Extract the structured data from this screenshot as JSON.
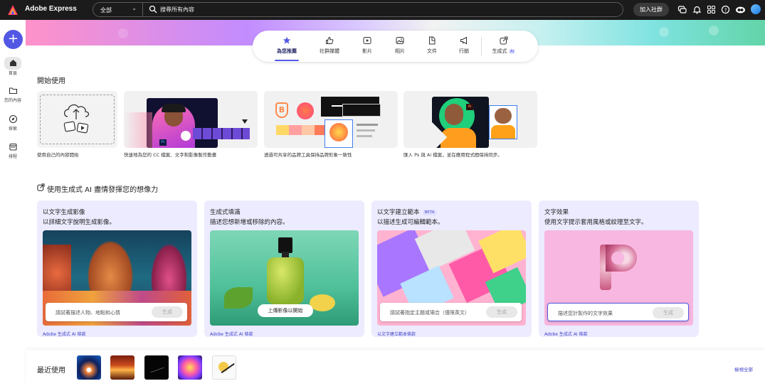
{
  "app": {
    "title": "Adobe Express"
  },
  "search": {
    "scope": "全部",
    "placeholder": "搜尋所有內容"
  },
  "header": {
    "join_label": "加入社群"
  },
  "rail": {
    "items": [
      {
        "label": "首頁"
      },
      {
        "label": "您的內容"
      },
      {
        "label": "探索"
      },
      {
        "label": "排程"
      }
    ]
  },
  "tabs": [
    {
      "label": "為您推薦"
    },
    {
      "label": "社群媒體"
    },
    {
      "label": "影片"
    },
    {
      "label": "相片"
    },
    {
      "label": "文件"
    },
    {
      "label": "行銷"
    },
    {
      "label": "生成式",
      "badge": "AI"
    }
  ],
  "getting_started": {
    "title": "開始使用",
    "cards": [
      {
        "caption": "使用自己的內容開始"
      },
      {
        "caption": "快速地為您的 CC 檔案、文字和影像製作動畫"
      },
      {
        "caption": "透過可共享的品牌工具保持品牌形象一致性"
      },
      {
        "caption": "匯入 Ps 與 Ai 檔案，並在應用程式間保持同步。"
      }
    ]
  },
  "ai_section": {
    "title": "使用生成式 AI 盡情發揮您的想像力",
    "cards": [
      {
        "title": "以文字生成影像",
        "subtitle": "以詳細文字說明生成影像。",
        "prompt": "請試著描述人物、地點和心情",
        "button": "生成",
        "footer": "Adobe 生成式 AI 條款"
      },
      {
        "title": "生成式填滿",
        "subtitle": "描述您想新增或移除的內容。",
        "button": "上傳影像以開始",
        "footer": "Adobe 生成式 AI 條款"
      },
      {
        "title": "以文字建立範本",
        "badge": "BETA",
        "subtitle": "以描述生成可編輯範本。",
        "prompt": "請試著指定主題或場合（僅限英文）",
        "button": "生成",
        "footer": "以文字建立範本條款"
      },
      {
        "title": "文字效果",
        "subtitle": "使用文字提示套用風格或紋理至文字。",
        "prompt": "描述您計製作的文字效果",
        "button": "生成",
        "footer": "Adobe 生成式 AI 條款"
      }
    ]
  },
  "recent": {
    "title": "最近使用",
    "view_all": "檢視全部"
  },
  "colors": {
    "accent": "#5258e4",
    "topbar": "#1b1b1b",
    "card_lavender": "#ecebff"
  }
}
